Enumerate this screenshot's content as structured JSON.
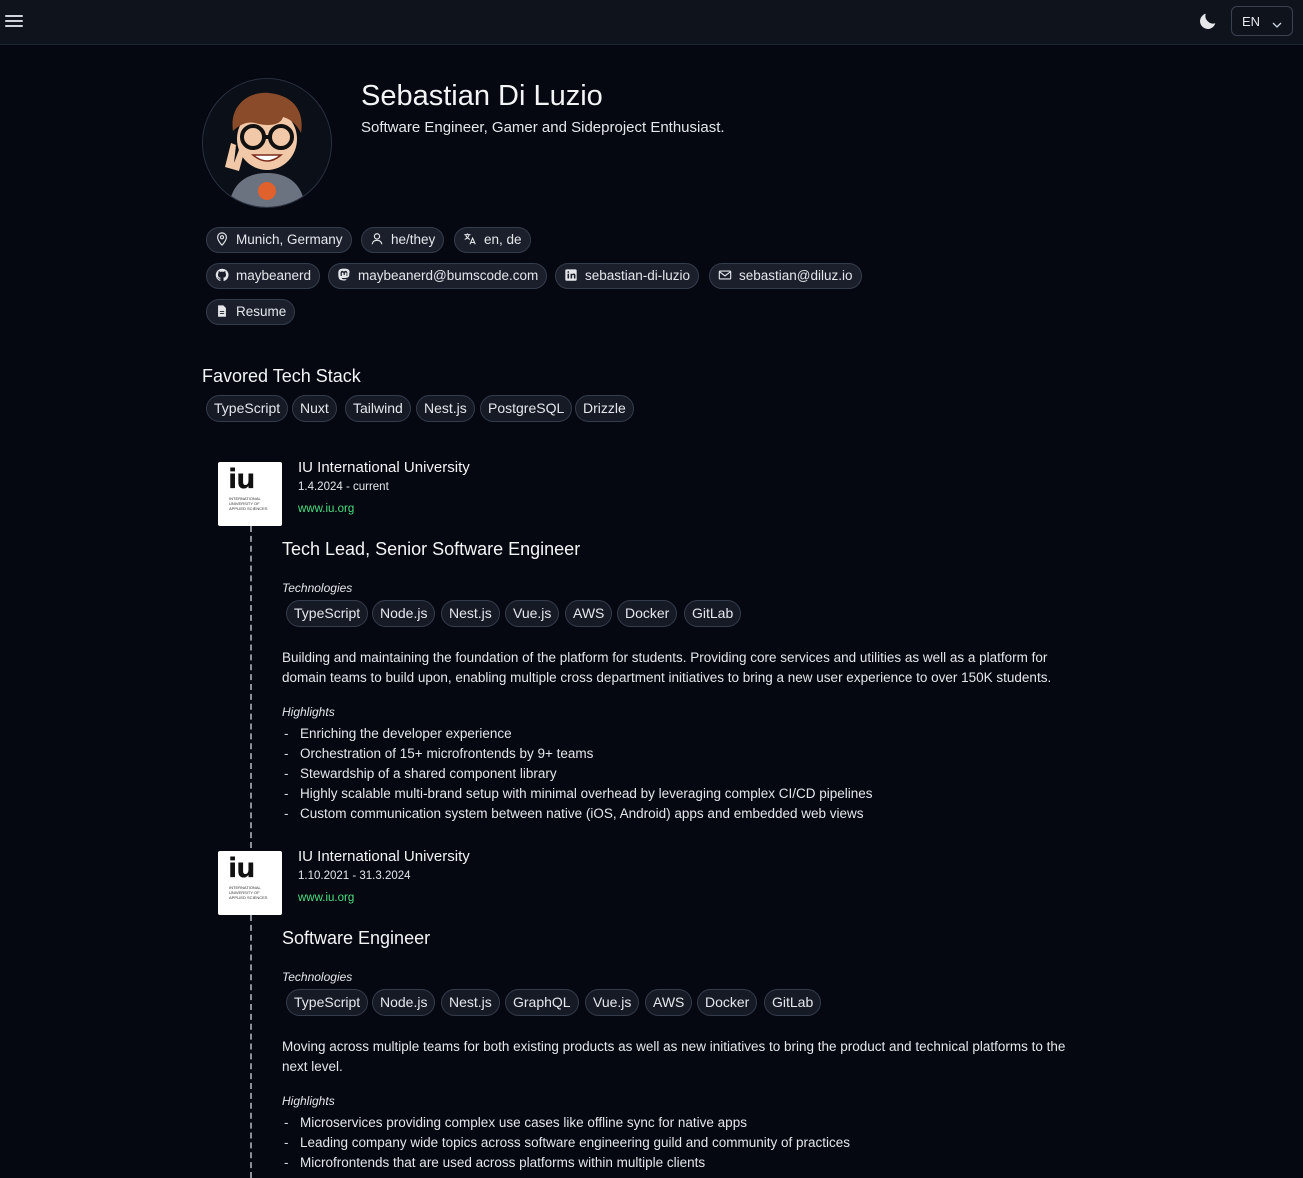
{
  "header": {
    "language": "EN"
  },
  "profile": {
    "name": "Sebastian Di Luzio",
    "tagline": "Software Engineer, Gamer and Sideproject Enthusiast.",
    "location": "Munich, Germany",
    "pronouns": "he/they",
    "languages": "en, de",
    "github": "maybeanerd",
    "mastodon": "maybeanerd@bumscode.com",
    "linkedin": "sebastian-di-luzio",
    "email": "sebastian@diluz.io",
    "resume": "Resume"
  },
  "tech_stack": {
    "title": "Favored Tech Stack",
    "items": [
      "TypeScript",
      "Nuxt",
      "Tailwind",
      "Nest.js",
      "PostgreSQL",
      "Drizzle"
    ]
  },
  "experience": [
    {
      "logo_text": "iu",
      "logo_sub": "INTERNATIONAL UNIVERSITY OF APPLIED SCIENCES",
      "company": "IU International University",
      "dates": "1.4.2024 - current",
      "website": "www.iu.org",
      "role": "Tech Lead, Senior Software Engineer",
      "technologies_label": "Technologies",
      "technologies": [
        "TypeScript",
        "Node.js",
        "Nest.js",
        "Vue.js",
        "AWS",
        "Docker",
        "GitLab"
      ],
      "description": "Building and maintaining the foundation of the platform for students. Providing core services and utilities as well as a platform for domain teams to build upon, enabling multiple cross department initiatives to bring a new user experience to over 150K students.",
      "highlights_label": "Highlights",
      "highlights": [
        "Enriching the developer experience",
        "Orchestration of 15+ microfrontends by 9+ teams",
        "Stewardship of a shared component library",
        "Highly scalable multi-brand setup with minimal overhead by leveraging complex CI/CD pipelines",
        "Custom communication system between native (iOS, Android) apps and embedded web views"
      ]
    },
    {
      "logo_text": "iu",
      "logo_sub": "INTERNATIONAL UNIVERSITY OF APPLIED SCIENCES",
      "company": "IU International University",
      "dates": "1.10.2021 - 31.3.2024",
      "website": "www.iu.org",
      "role": "Software Engineer",
      "technologies_label": "Technologies",
      "technologies": [
        "TypeScript",
        "Node.js",
        "Nest.js",
        "GraphQL",
        "Vue.js",
        "AWS",
        "Docker",
        "GitLab"
      ],
      "description": "Moving across multiple teams for both existing products as well as new initiatives to bring the product and technical platforms to the next level.",
      "highlights_label": "Highlights",
      "highlights": [
        "Microservices providing complex use cases like offline sync for native apps",
        "Leading company wide topics across software engineering guild and community of practices",
        "Microfrontends that are used across platforms within multiple clients"
      ]
    }
  ],
  "icons": {
    "menu": "menu-icon",
    "theme": "moon-icon",
    "location": "map-pin-icon",
    "pronouns": "user-icon",
    "languages": "translate-icon",
    "github": "github-icon",
    "mastodon": "mastodon-icon",
    "linkedin": "linkedin-icon",
    "email": "mail-icon",
    "resume": "document-icon"
  },
  "colors": {
    "background": "#050810",
    "link": "#4ade80"
  }
}
